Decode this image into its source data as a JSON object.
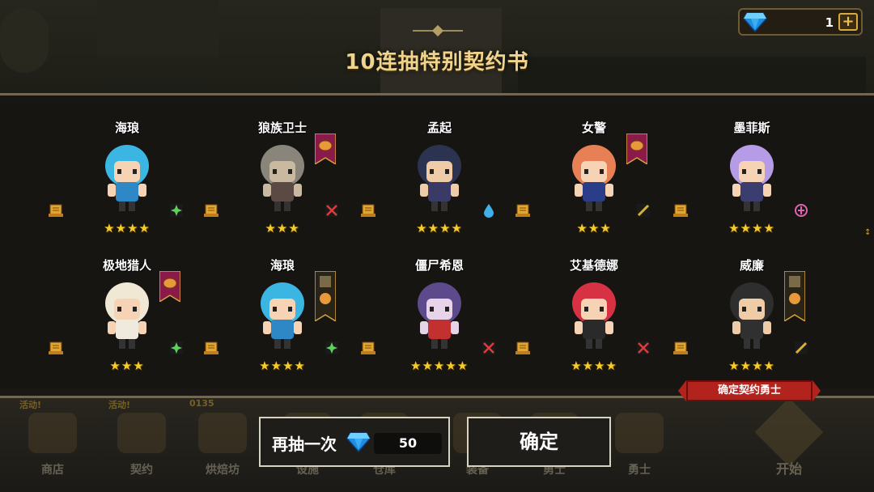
{
  "dialog": {
    "title": "10连抽特别契约书"
  },
  "gems": {
    "count": "1",
    "plus": "+"
  },
  "colors": {
    "gem": "#2aa9f0",
    "star": "#f6cc2a",
    "ribbon": "#b3231d",
    "banner": "#8a1b49",
    "gold": "#d9a93a"
  },
  "results": [
    {
      "name": "海琅",
      "stars": "★★★★",
      "class_icon": "shuriken-icon",
      "class_color": "#5fd15a",
      "banner": "none",
      "hair": "#3bb6e3",
      "outfit": "#2e88c5",
      "skin": "#f6d3b5"
    },
    {
      "name": "狼族卫士",
      "stars": "★★★",
      "class_icon": "crossed-swords-icon",
      "class_color": "#e23a3a",
      "banner": "bread",
      "hair": "#8a857b",
      "outfit": "#5b4a44",
      "skin": "#c8b9a0"
    },
    {
      "name": "孟起",
      "stars": "★★★★",
      "class_icon": "water-drop-icon",
      "class_color": "#3fb0ea",
      "banner": "none",
      "hair": "#2c3350",
      "outfit": "#3a3a66",
      "skin": "#f0cba8"
    },
    {
      "name": "女警",
      "stars": "★★★",
      "class_icon": "baton-icon",
      "class_color": "#d8b234",
      "banner": "bread",
      "hair": "#e88055",
      "outfit": "#2b3d88",
      "skin": "#f6d3b5"
    },
    {
      "name": "墨菲斯",
      "stars": "★★★★",
      "class_icon": "ankh-icon",
      "class_color": "#e065b0",
      "banner": "none",
      "hair": "#b69be6",
      "outfit": "#3a3d6e",
      "skin": "#f6d3b5"
    },
    {
      "name": "极地猎人",
      "stars": "★★★",
      "class_icon": "shuriken-icon",
      "class_color": "#5fd15a",
      "banner": "bread",
      "hair": "#f0e8d4",
      "outfit": "#efeadd",
      "skin": "#f6d3b5"
    },
    {
      "name": "海琅",
      "stars": "★★★★",
      "class_icon": "shuriken-icon",
      "class_color": "#5fd15a",
      "banner": "tall",
      "hair": "#3bb6e3",
      "outfit": "#2e88c5",
      "skin": "#f6d3b5"
    },
    {
      "name": "僵尸希恩",
      "stars": "★★★★★",
      "class_icon": "crossed-swords-icon",
      "class_color": "#e23a3a",
      "banner": "none",
      "hair": "#5d4a8c",
      "outfit": "#c23030",
      "skin": "#e8d4e8"
    },
    {
      "name": "艾基德娜",
      "stars": "★★★★",
      "class_icon": "crossed-swords-icon",
      "class_color": "#e23a3a",
      "banner": "none",
      "hair": "#d63244",
      "outfit": "#2a2a2a",
      "skin": "#f6d3b5"
    },
    {
      "name": "威廉",
      "stars": "★★★★",
      "class_icon": "baton-icon",
      "class_color": "#d8b234",
      "banner": "tall",
      "hair": "#2e2e2e",
      "outfit": "#303030",
      "skin": "#f0cba8"
    }
  ],
  "actions": {
    "redraw_label": "再抽一次",
    "redraw_cost": "50",
    "confirm_label": "确定",
    "confirm_ribbon": "确定契约勇士"
  },
  "nav": [
    {
      "label": "商店",
      "badge": "活动!"
    },
    {
      "label": "契约",
      "badge": "活动!"
    },
    {
      "label": "烘焙坊",
      "badge": "0135"
    },
    {
      "label": "设施",
      "badge": ""
    },
    {
      "label": "仓库",
      "badge": ""
    },
    {
      "label": "装备",
      "badge": ""
    },
    {
      "label": "勇士",
      "badge": ""
    },
    {
      "label": "勇士",
      "badge": ""
    }
  ],
  "start": {
    "label": "开始"
  }
}
